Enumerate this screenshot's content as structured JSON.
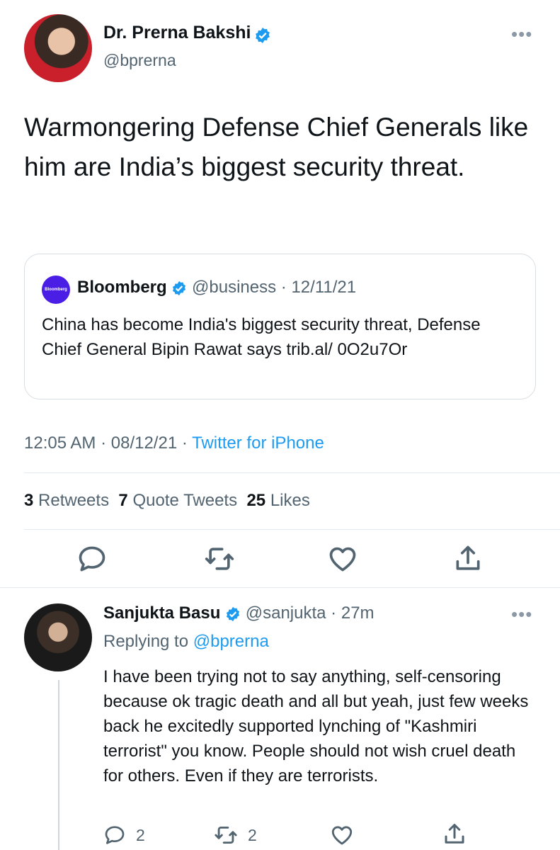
{
  "tweet": {
    "author_name": "Dr. Prerna Bakshi",
    "author_handle": "@bprerna",
    "text": "Warmongering Defense Chief Generals like him are India’s biggest security threat.",
    "more": "•••",
    "time": "12:05 AM",
    "date": "08/12/21",
    "source": "Twitter for iPhone",
    "sep": "·"
  },
  "quote": {
    "logo_text": "Bloomberg",
    "name": "Bloomberg",
    "handle": "@business",
    "date": "12/11/21",
    "text": "China has become India's biggest security threat, Defense Chief General Bipin Rawat says trib.al/ 0O2u7Or"
  },
  "stats": {
    "retweets_count": "3",
    "retweets_label": "Retweets",
    "quote_count": "7",
    "quote_label": "Quote Tweets",
    "likes_count": "25",
    "likes_label": "Likes"
  },
  "reply": {
    "author_name": "Sanjukta Basu",
    "author_handle": "@sanjukta",
    "time": "27m",
    "replying_prefix": "Replying to",
    "replying_to": "@bprerna",
    "text": "I have been trying not to say anything, self-censoring because ok tragic death and all but yeah, just few weeks back he excitedly supported lynching of \"Kashmiri terrorist\" you know. People should not wish cruel death for others. Even if they are terrorists.",
    "reply_count": "2",
    "retweet_count": "2"
  },
  "colors": {
    "accent": "#1d9bf0",
    "verified": "#1d9bf0",
    "secondary_text": "#536471"
  }
}
